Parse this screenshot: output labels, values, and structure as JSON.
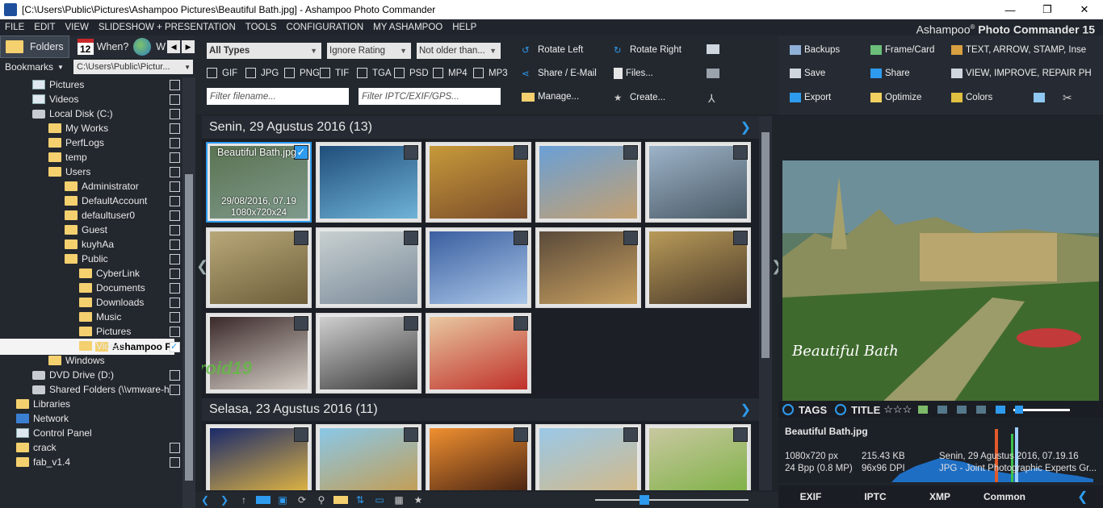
{
  "window": {
    "title": "[C:\\Users\\Public\\Pictures\\Ashampoo Pictures\\Beautiful Bath.jpg] - Ashampoo Photo Commander",
    "min": "—",
    "max": "❐",
    "close": "✕"
  },
  "menu": [
    "FILE",
    "EDIT",
    "VIEW",
    "SLIDESHOW + PRESENTATION",
    "TOOLS",
    "CONFIGURATION",
    "MY ASHAMPOO",
    "HELP"
  ],
  "brand": {
    "name": "Ashampoo",
    "reg": "®",
    "product": "Photo Commander 15"
  },
  "left": {
    "folders_label": "Folders",
    "when_label": "When?",
    "w_label": "W",
    "cal_day": "12",
    "bookmarks_label": "Bookmarks",
    "path": "C:\\Users\\Public\\Pictur...",
    "tree": [
      {
        "label": "Pictures",
        "indent": 40,
        "icon": "pc",
        "cb": true
      },
      {
        "label": "Videos",
        "indent": 40,
        "icon": "pc",
        "cb": true
      },
      {
        "label": "Local Disk (C:)",
        "indent": 40,
        "icon": "disk",
        "cb": true
      },
      {
        "label": "My Works",
        "indent": 60,
        "icon": "folder",
        "cb": true
      },
      {
        "label": "PerfLogs",
        "indent": 60,
        "icon": "folder",
        "cb": true
      },
      {
        "label": "temp",
        "indent": 60,
        "icon": "folder",
        "cb": true
      },
      {
        "label": "Users",
        "indent": 60,
        "icon": "folder",
        "cb": true
      },
      {
        "label": "Administrator",
        "indent": 80,
        "icon": "folder",
        "cb": true
      },
      {
        "label": "DefaultAccount",
        "indent": 80,
        "icon": "folder",
        "cb": true
      },
      {
        "label": "defaultuser0",
        "indent": 80,
        "icon": "folder",
        "cb": true
      },
      {
        "label": "Guest",
        "indent": 80,
        "icon": "folder",
        "cb": true
      },
      {
        "label": "kuyhAa",
        "indent": 80,
        "icon": "folder",
        "cb": true
      },
      {
        "label": "Public",
        "indent": 80,
        "icon": "folder",
        "cb": true
      },
      {
        "label": "CyberLink",
        "indent": 98,
        "icon": "folder",
        "cb": true
      },
      {
        "label": "Documents",
        "indent": 98,
        "icon": "folder",
        "cb": true
      },
      {
        "label": "Downloads",
        "indent": 98,
        "icon": "folder",
        "cb": true
      },
      {
        "label": "Music",
        "indent": 98,
        "icon": "folder",
        "cb": true
      },
      {
        "label": "Pictures",
        "indent": 98,
        "icon": "folder",
        "cb": true
      },
      {
        "label": "Ashampoo Pi",
        "indent": 118,
        "icon": "folder",
        "cb": true,
        "selected": true
      },
      {
        "label": "Videos",
        "indent": 98,
        "icon": "folder",
        "cb": false
      },
      {
        "label": "Windows",
        "indent": 60,
        "icon": "folder",
        "cb": false
      },
      {
        "label": "DVD Drive (D:)",
        "indent": 40,
        "icon": "disk",
        "cb": true
      },
      {
        "label": "Shared Folders (\\\\vmware-h",
        "indent": 40,
        "icon": "disk",
        "cb": true
      },
      {
        "label": "Libraries",
        "indent": 20,
        "icon": "folder",
        "cb": false
      },
      {
        "label": "Network",
        "indent": 20,
        "icon": "net",
        "cb": false
      },
      {
        "label": "Control Panel",
        "indent": 20,
        "icon": "pc",
        "cb": false
      },
      {
        "label": "crack",
        "indent": 20,
        "icon": "folder",
        "cb": true
      },
      {
        "label": "fab_v1.4",
        "indent": 20,
        "icon": "folder",
        "cb": true
      }
    ]
  },
  "filters": {
    "type": "All Types",
    "rating": "Ignore Rating",
    "age": "Not older than...",
    "formats": [
      "GIF",
      "JPG",
      "PNG",
      "TIF",
      "TGA",
      "PSD",
      "MP4",
      "MP3"
    ],
    "filename_placeholder": "Filter filename...",
    "meta_placeholder": "Filter IPTC/EXIF/GPS..."
  },
  "center_tools": [
    "Rotate Left",
    "Rotate Right",
    "Share / E-Mail",
    "Files...",
    "Manage...",
    "Create..."
  ],
  "groups": [
    {
      "title": "Senin, 29 Agustus 2016 (13)",
      "count": 13
    },
    {
      "title": "Selasa, 23 Agustus 2016 (11)",
      "count": 5
    }
  ],
  "active_thumb": {
    "name": "Beautiful Bath.jpg",
    "date": "29/08/2016, 07.19",
    "size": "1080x720x24"
  },
  "watermark": "Kuyhaa-android19",
  "right_tools": [
    "Backups",
    "Frame/Card",
    "TEXT, ARROW, STAMP, Inse",
    "Save",
    "Share",
    "VIEW, IMPROVE, REPAIR PH",
    "Export",
    "Optimize",
    "Colors"
  ],
  "preview_caption": "Beautiful Bath",
  "tagbar": {
    "tags": "TAGS",
    "title": "TITLE",
    "stars": "☆☆☆"
  },
  "info": {
    "filename": "Beautiful Bath.jpg",
    "dims": "1080x720 px",
    "bpp": "24 Bpp (0.8 MP)",
    "filesize": "215.43 KB",
    "dpi": "96x96 DPI",
    "date": "Senin, 29 Agustus 2016, 07.19.16",
    "format": "JPG - Joint Photographic Experts Gr..."
  },
  "tabs": [
    "EXIF",
    "IPTC",
    "XMP",
    "Common"
  ],
  "colors": {
    "accent": "#2e9bee",
    "bg": "#1f232a",
    "folder": "#f4d06f"
  }
}
